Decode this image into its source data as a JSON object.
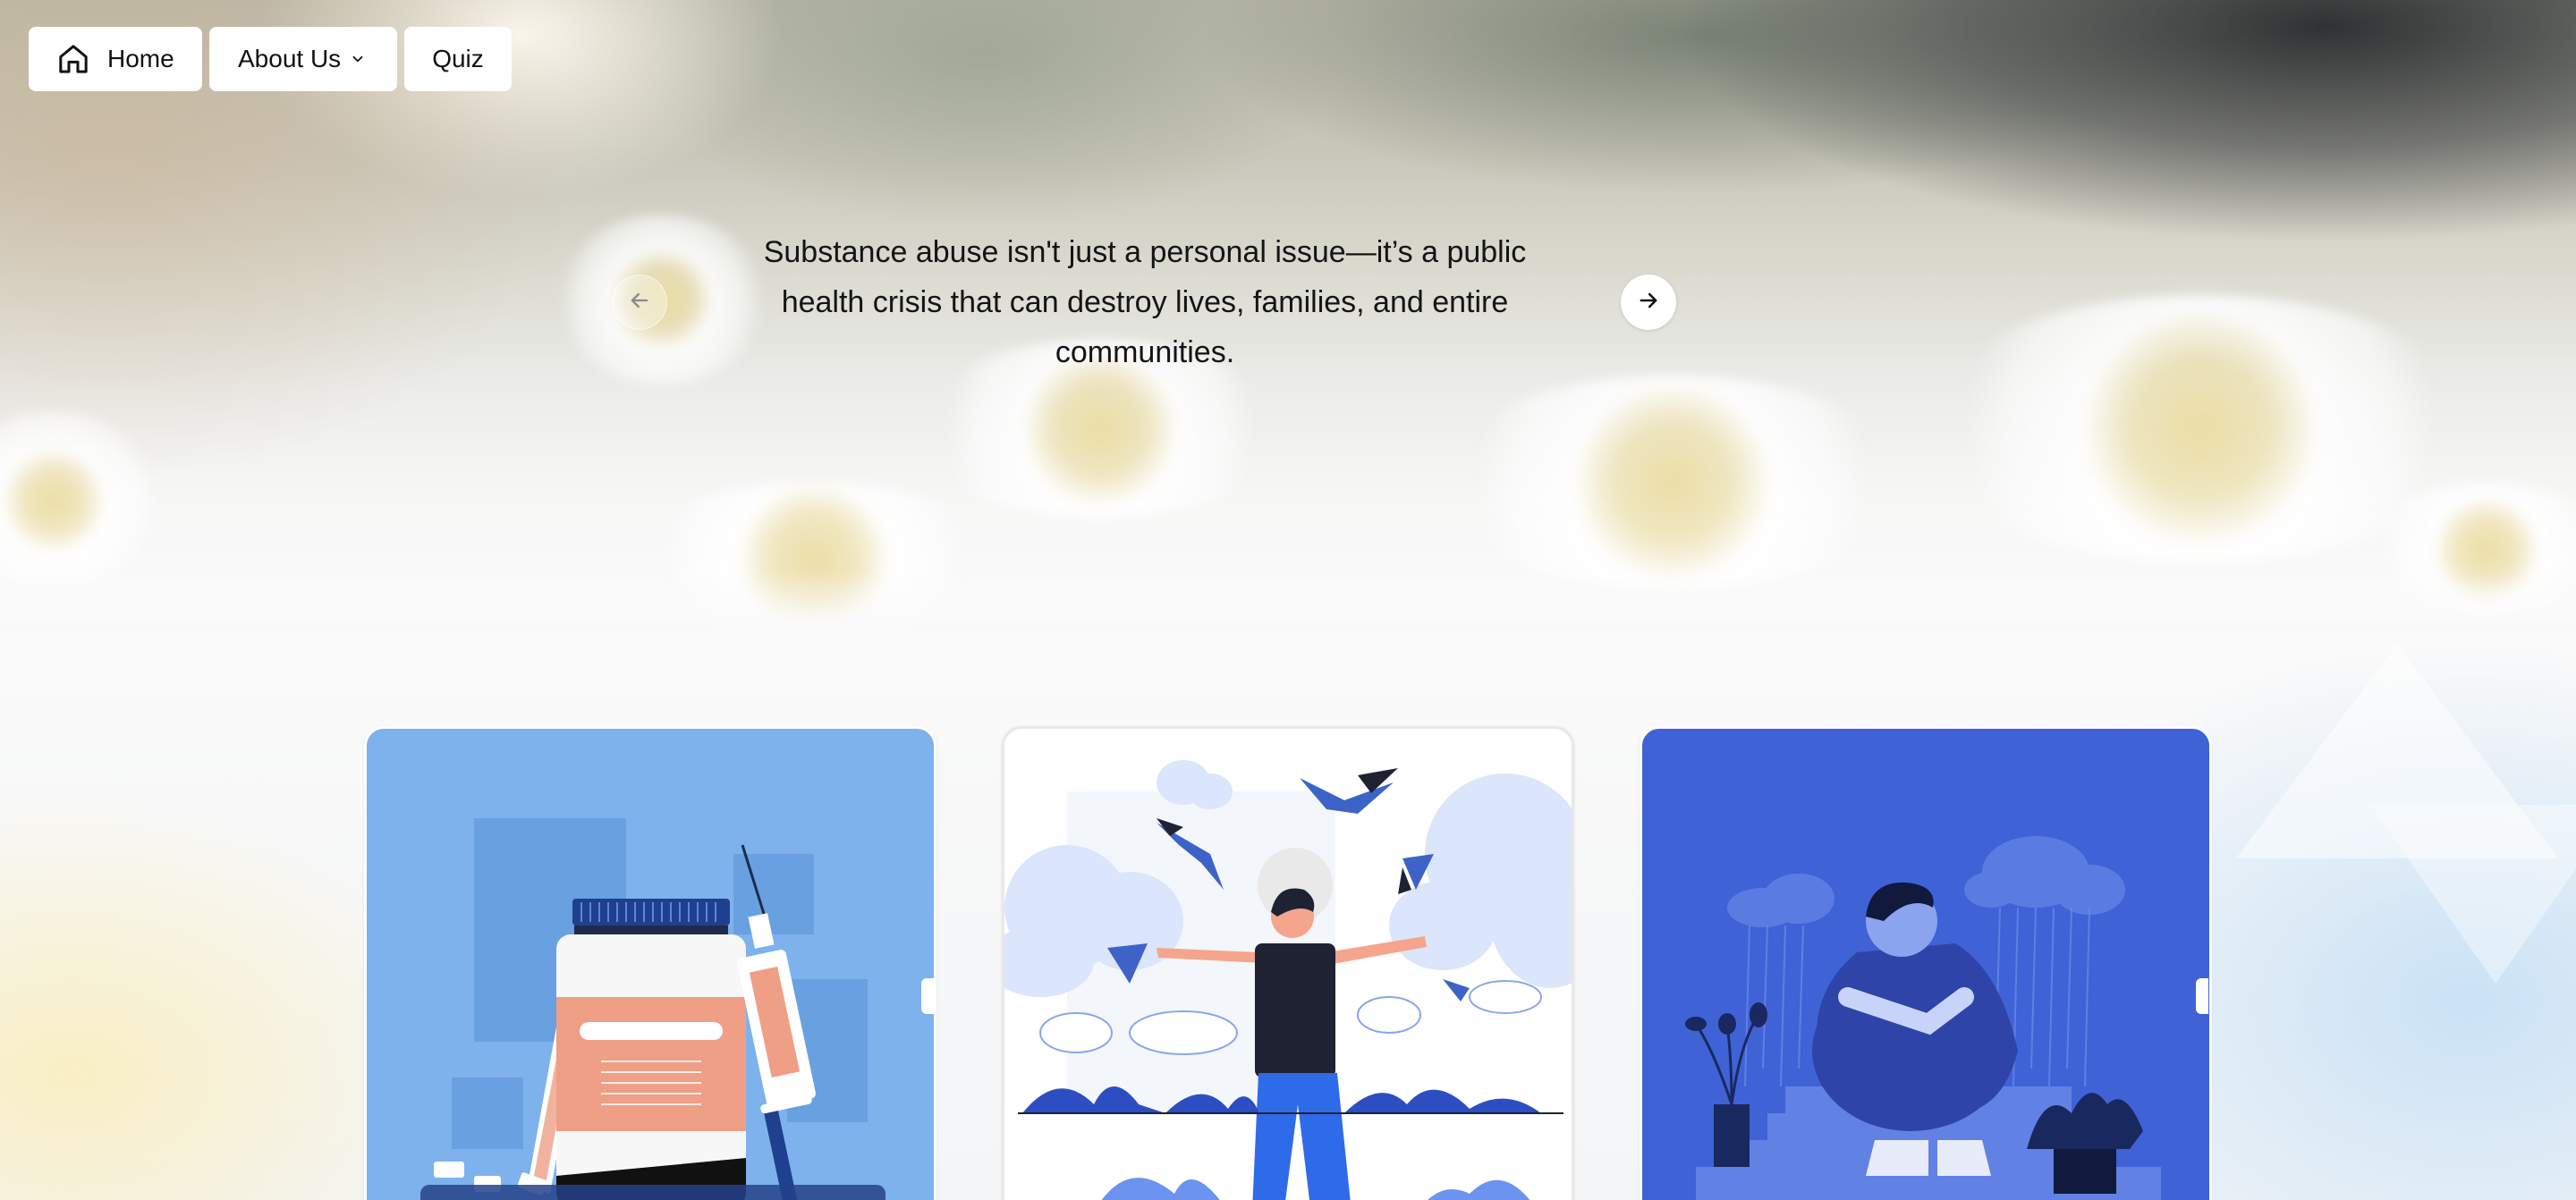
{
  "nav": {
    "home_label": "Home",
    "about_label": "About Us",
    "quiz_label": "Quiz"
  },
  "carousel": {
    "text": "Substance abuse isn't just a personal issue—it’s a public health crisis that can destroy lives, families, and entire communities."
  },
  "colors": {
    "card1_bg": "#7db2ec",
    "card2_bg": "#ffffff",
    "card3_bg": "#3f63d6",
    "accent_salmon": "#ee9f86",
    "accent_navy": "#1f3f8f"
  }
}
